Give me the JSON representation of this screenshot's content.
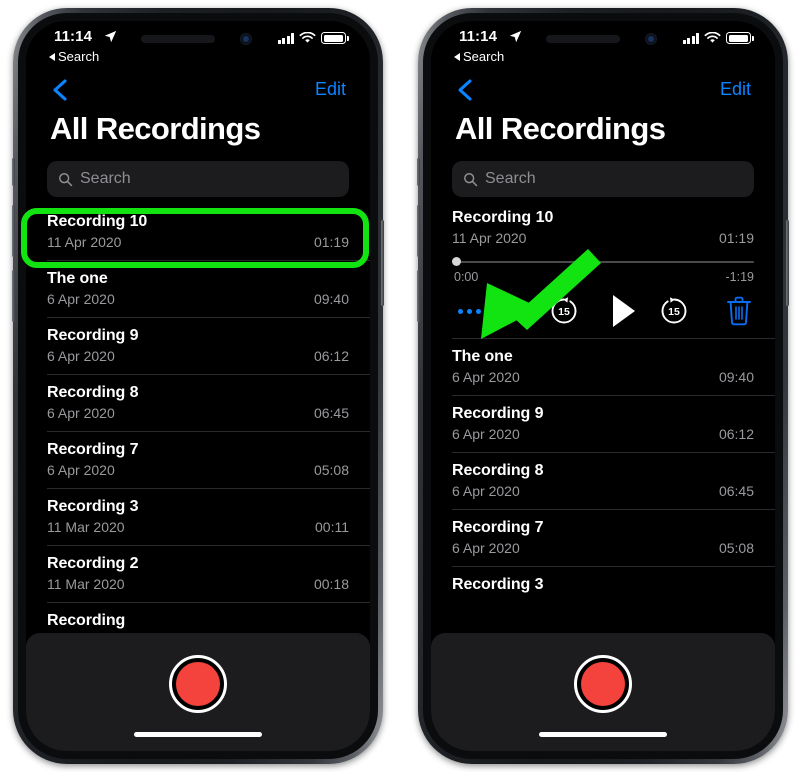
{
  "status_bar": {
    "time": "11:14",
    "back_app_label": "Search",
    "location_icon": "location-arrow-icon",
    "signal_icon": "cellular-signal-icon",
    "wifi_icon": "wifi-icon",
    "battery_icon": "battery-icon"
  },
  "nav": {
    "back_icon": "chevron-left-icon",
    "edit_label": "Edit"
  },
  "page_title": "All Recordings",
  "search": {
    "placeholder": "Search",
    "icon": "search-icon"
  },
  "record_bar": {
    "record_button_label": "record-button",
    "home_indicator": "home-indicator"
  },
  "annotation": {
    "highlight_color": "#12e412",
    "arrow_color": "#12e412",
    "highlight_target": "Recording 10",
    "arrow_target": "more-options-button"
  },
  "left_phone": {
    "recordings": [
      {
        "name": "Recording 10",
        "date": "11 Apr 2020",
        "duration": "01:19",
        "selected": true
      },
      {
        "name": "The one",
        "date": "6 Apr 2020",
        "duration": "09:40",
        "selected": false
      },
      {
        "name": "Recording 9",
        "date": "6 Apr 2020",
        "duration": "06:12",
        "selected": false
      },
      {
        "name": "Recording 8",
        "date": "6 Apr 2020",
        "duration": "06:45",
        "selected": false
      },
      {
        "name": "Recording 7",
        "date": "6 Apr 2020",
        "duration": "05:08",
        "selected": false
      },
      {
        "name": "Recording 3",
        "date": "11 Mar 2020",
        "duration": "00:11",
        "selected": false
      },
      {
        "name": "Recording 2",
        "date": "11 Mar 2020",
        "duration": "00:18",
        "selected": false
      },
      {
        "name": "Recording",
        "date": "",
        "duration": "",
        "selected": false
      }
    ]
  },
  "right_phone": {
    "expanded": {
      "name": "Recording 10",
      "date": "11 Apr 2020",
      "duration": "01:19",
      "elapsed_time": "0:00",
      "remaining_time": "-1:19",
      "progress_percent": 0,
      "controls": {
        "more_label": "more-options-button",
        "skip_back_label": "15",
        "skip_back_icon": "rewind-15-icon",
        "play_icon": "play-icon",
        "skip_forward_label": "15",
        "skip_forward_icon": "forward-15-icon",
        "delete_icon": "trash-icon"
      }
    },
    "recordings": [
      {
        "name": "The one",
        "date": "6 Apr 2020",
        "duration": "09:40"
      },
      {
        "name": "Recording 9",
        "date": "6 Apr 2020",
        "duration": "06:12"
      },
      {
        "name": "Recording 8",
        "date": "6 Apr 2020",
        "duration": "06:45"
      },
      {
        "name": "Recording 7",
        "date": "6 Apr 2020",
        "duration": "05:08"
      },
      {
        "name": "Recording 3",
        "date": "",
        "duration": ""
      }
    ]
  },
  "colors": {
    "accent_blue": "#0a84ff",
    "record_red": "#f4433c",
    "annotation_green": "#12e412",
    "screen_black": "#000000",
    "card_gray": "#1c1c1e"
  }
}
